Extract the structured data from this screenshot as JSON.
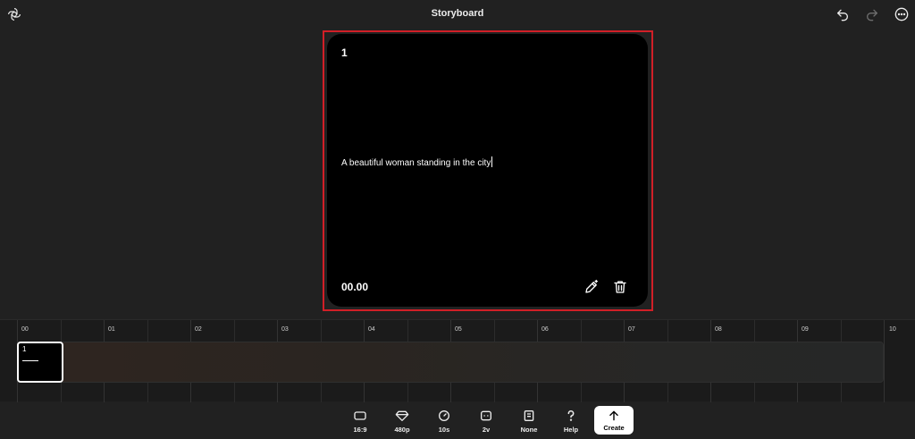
{
  "app": {
    "title": "Storyboard"
  },
  "card": {
    "index": "1",
    "prompt": "A beautiful woman standing in the city",
    "time": "00.00"
  },
  "timeline": {
    "ticks": [
      "00",
      "01",
      "02",
      "03",
      "04",
      "05",
      "06",
      "07",
      "08",
      "09",
      "10"
    ],
    "clips": [
      {
        "label": "1"
      }
    ]
  },
  "toolbar": {
    "aspect": "16:9",
    "resolution": "480p",
    "duration": "10s",
    "variants": "2v",
    "preset": "None",
    "help": "Help",
    "create": "Create"
  },
  "colors": {
    "background": "#212121",
    "card": "#000000",
    "selection_outline": "#d11f27",
    "create_button": "#ffffff"
  },
  "icons": {
    "logo": "openai-logo-icon",
    "undo": "undo-icon",
    "redo": "redo-icon",
    "more": "more-options-icon",
    "edit": "edit-pencil-icon",
    "delete": "trash-icon",
    "aspect": "aspect-ratio-icon",
    "resolution": "diamond-icon",
    "duration": "clock-icon",
    "variants": "variants-icon",
    "preset": "book-icon",
    "help": "question-icon",
    "create": "arrow-up-icon"
  }
}
